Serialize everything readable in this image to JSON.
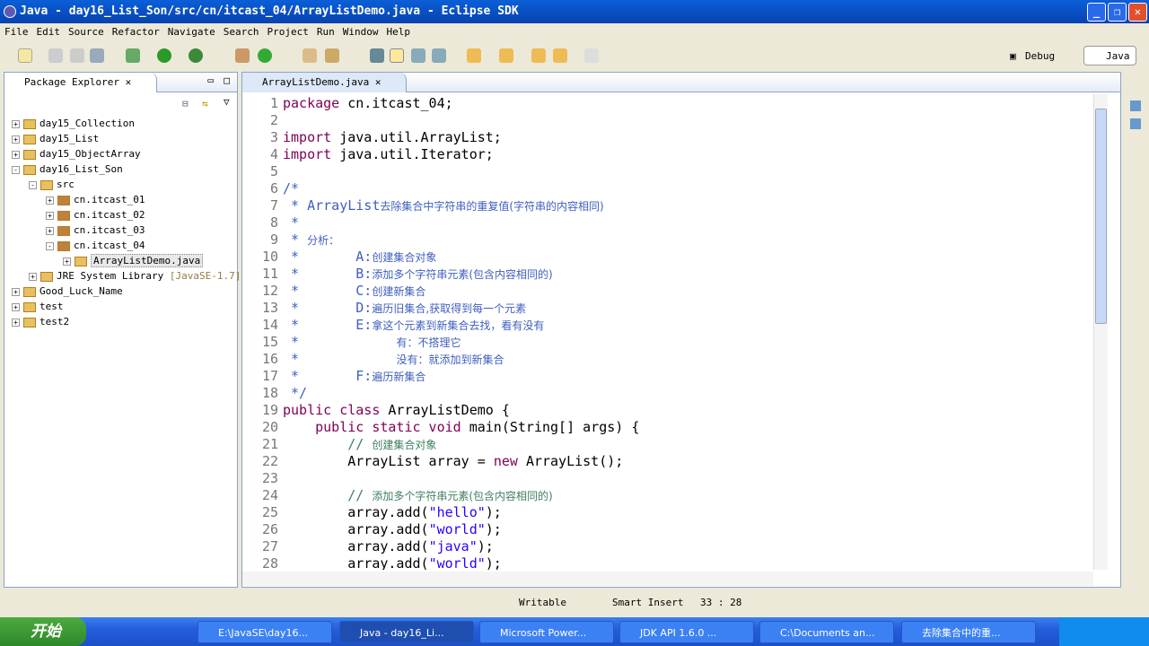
{
  "window": {
    "title": "Java - day16_List_Son/src/cn/itcast_04/ArrayListDemo.java - Eclipse SDK"
  },
  "menu": [
    "File",
    "Edit",
    "Source",
    "Refactor",
    "Navigate",
    "Search",
    "Project",
    "Run",
    "Window",
    "Help"
  ],
  "perspectives": {
    "debug": "Debug",
    "java": "Java"
  },
  "package_explorer": {
    "title": "Package Explorer",
    "items": [
      {
        "label": "day15_Collection",
        "level": 0,
        "kind": "project",
        "exp": "+"
      },
      {
        "label": "day15_List",
        "level": 0,
        "kind": "project",
        "exp": "+"
      },
      {
        "label": "day15_ObjectArray",
        "level": 0,
        "kind": "project",
        "exp": "+"
      },
      {
        "label": "day16_List_Son",
        "level": 0,
        "kind": "project",
        "exp": "-"
      },
      {
        "label": "src",
        "level": 1,
        "kind": "src",
        "exp": "-"
      },
      {
        "label": "cn.itcast_01",
        "level": 2,
        "kind": "package",
        "exp": "+"
      },
      {
        "label": "cn.itcast_02",
        "level": 2,
        "kind": "package",
        "exp": "+"
      },
      {
        "label": "cn.itcast_03",
        "level": 2,
        "kind": "package",
        "exp": "+"
      },
      {
        "label": "cn.itcast_04",
        "level": 2,
        "kind": "package",
        "exp": "-"
      },
      {
        "label": "ArrayListDemo.java",
        "level": 3,
        "kind": "java",
        "exp": "+",
        "selected": true
      },
      {
        "label": "JRE System Library",
        "suffix": "[JavaSE-1.7]",
        "level": 1,
        "kind": "lib",
        "exp": "+"
      },
      {
        "label": "Good_Luck_Name",
        "level": 0,
        "kind": "project",
        "exp": "+"
      },
      {
        "label": "test",
        "level": 0,
        "kind": "project",
        "exp": "+"
      },
      {
        "label": "test2",
        "level": 0,
        "kind": "project",
        "exp": "+"
      }
    ]
  },
  "editor": {
    "tab": "ArrayListDemo.java",
    "lines": [
      [
        [
          "package ",
          "k"
        ],
        [
          "cn.itcast_04;",
          ""
        ]
      ],
      [],
      [
        [
          "import ",
          "k"
        ],
        [
          "java.util.ArrayList;",
          ""
        ]
      ],
      [
        [
          "import ",
          "k"
        ],
        [
          "java.util.Iterator;",
          ""
        ]
      ],
      [],
      [
        [
          "/*",
          "j"
        ]
      ],
      [
        [
          " * ArrayList",
          "j"
        ],
        [
          "去除集合中字符串的重复值(字符串的内容相同)",
          "j cn"
        ]
      ],
      [
        [
          " *",
          "j"
        ]
      ],
      [
        [
          " * ",
          "j"
        ],
        [
          "分析：",
          "j cn"
        ]
      ],
      [
        [
          " *       A:",
          "j"
        ],
        [
          "创建集合对象",
          "j cn"
        ]
      ],
      [
        [
          " *       B:",
          "j"
        ],
        [
          "添加多个字符串元素(包含内容相同的)",
          "j cn"
        ]
      ],
      [
        [
          " *       C:",
          "j"
        ],
        [
          "创建新集合",
          "j cn"
        ]
      ],
      [
        [
          " *       D:",
          "j"
        ],
        [
          "遍历旧集合,获取得到每一个元素",
          "j cn"
        ]
      ],
      [
        [
          " *       E:",
          "j"
        ],
        [
          "拿这个元素到新集合去找，看有没有",
          "j cn"
        ]
      ],
      [
        [
          " *            ",
          "j"
        ],
        [
          "有：不搭理它",
          "j cn"
        ]
      ],
      [
        [
          " *            ",
          "j"
        ],
        [
          "没有：就添加到新集合",
          "j cn"
        ]
      ],
      [
        [
          " *       F:",
          "j"
        ],
        [
          "遍历新集合",
          "j cn"
        ]
      ],
      [
        [
          " */",
          "j"
        ]
      ],
      [
        [
          "public class ",
          "k"
        ],
        [
          "ArrayListDemo {",
          ""
        ]
      ],
      [
        [
          "    public static void ",
          "k"
        ],
        [
          "main(String[] args) {",
          ""
        ]
      ],
      [
        [
          "        // ",
          "c"
        ],
        [
          "创建集合对象",
          "c cn"
        ]
      ],
      [
        [
          "        ArrayList array = ",
          ""
        ],
        [
          "new ",
          "k"
        ],
        [
          "ArrayList();",
          ""
        ]
      ],
      [],
      [
        [
          "        // ",
          "c"
        ],
        [
          "添加多个字符串元素(包含内容相同的)",
          "c cn"
        ]
      ],
      [
        [
          "        array.add(",
          ""
        ],
        [
          "\"hello\"",
          "s"
        ],
        [
          ");",
          ""
        ]
      ],
      [
        [
          "        array.add(",
          ""
        ],
        [
          "\"world\"",
          "s"
        ],
        [
          ");",
          ""
        ]
      ],
      [
        [
          "        array.add(",
          ""
        ],
        [
          "\"java\"",
          "s"
        ],
        [
          ");",
          ""
        ]
      ],
      [
        [
          "        array.add(",
          ""
        ],
        [
          "\"world\"",
          "s"
        ],
        [
          ");",
          ""
        ]
      ]
    ]
  },
  "status": {
    "mode": "Writable",
    "insert": "Smart Insert",
    "position": "33 : 28"
  },
  "taskbar": {
    "start": "开始",
    "tasks": [
      "E:\\JavaSE\\day16...",
      "Java - day16_Li...",
      "Microsoft Power...",
      "JDK API 1.6.0 ...",
      "C:\\Documents an...",
      "去除集合中的重..."
    ]
  }
}
